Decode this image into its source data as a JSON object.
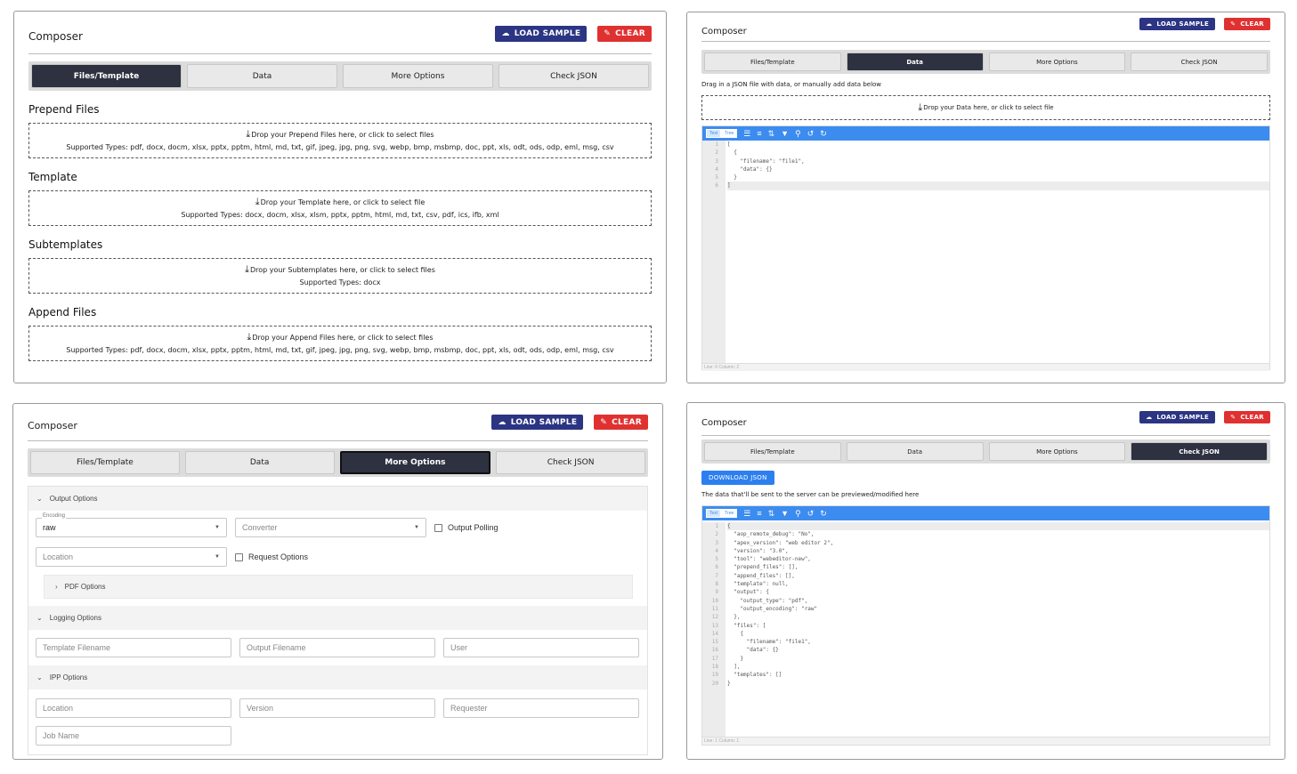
{
  "composer_title": "Composer",
  "buttons": {
    "load_sample": "LOAD SAMPLE",
    "clear": "CLEAR"
  },
  "tabs": [
    "Files/Template",
    "Data",
    "More Options",
    "Check JSON"
  ],
  "colors": {
    "accent": "#2c3583",
    "danger": "#e03131",
    "active_tab": "#2e3140",
    "editor_toolbar": "#3c8cf0"
  },
  "icons": {
    "load": "cloud-upload-icon",
    "clear": "broom-icon",
    "drop": "download-icon"
  },
  "files_template": {
    "sections": [
      {
        "title": "Prepend Files",
        "drop": "Drop your Prepend Files here, or click to select files",
        "types": "Supported Types: pdf, docx, docm, xlsx, pptx, pptm, html, md, txt, gif, jpeg, jpg, png, svg, webp, bmp, msbmp, doc, ppt, xls, odt, ods, odp, eml, msg, csv"
      },
      {
        "title": "Template",
        "drop": "Drop your Template here, or click to select file",
        "types": "Supported Types: docx, docm, xlsx, xlsm, pptx, pptm, html, md, txt, csv, pdf, ics, ifb, xml"
      },
      {
        "title": "Subtemplates",
        "drop": "Drop your Subtemplates here, or click to select files",
        "types": "Supported Types: docx"
      },
      {
        "title": "Append Files",
        "drop": "Drop your Append Files here, or click to select files",
        "types": "Supported Types: pdf, docx, docm, xlsx, pptx, pptm, html, md, txt, gif, jpeg, jpg, png, svg, webp, bmp, msbmp, doc, ppt, xls, odt, ods, odp, eml, msg, csv"
      }
    ]
  },
  "data_tab": {
    "hint": "Drag in a JSON file with data, or manually add data below",
    "drop": "Drop your Data here, or click to select file",
    "editor_modes": [
      "Text",
      "Tree"
    ],
    "lines": [
      "[",
      "  {",
      "    \"filename\": \"file1\",",
      "    \"data\": {}",
      "  }",
      "]"
    ],
    "line_numbers": [
      "1",
      "2",
      "3",
      "4",
      "5",
      "6"
    ],
    "status": "Line: 6    Column: 2"
  },
  "more_options": {
    "output_options": "Output Options",
    "encoding_label": "Encoding",
    "encoding_value": "raw",
    "converter_placeholder": "Converter",
    "output_polling": "Output Polling",
    "location_placeholder": "Location",
    "request_options": "Request Options",
    "pdf_options": "PDF Options",
    "logging_options": "Logging Options",
    "template_filename": "Template Filename",
    "output_filename": "Output Filename",
    "user": "User",
    "ipp_options": "IPP Options",
    "ipp_location": "Location",
    "version": "Version",
    "requester": "Requester",
    "job_name": "Job Name"
  },
  "check_json": {
    "download": "DOWNLOAD JSON",
    "hint": "The data that'll be sent to the server can be previewed/modified here",
    "editor_modes": [
      "Text",
      "Tree"
    ],
    "line_numbers": [
      "1",
      "2",
      "3",
      "4",
      "5",
      "6",
      "7",
      "8",
      "9",
      "10",
      "11",
      "12",
      "13",
      "14",
      "15",
      "16",
      "17",
      "18",
      "19",
      "20"
    ],
    "lines": [
      "{",
      "  \"aop_remote_debug\": \"No\",",
      "  \"apex_version\": \"web editor 2\",",
      "  \"version\": \"3.0\",",
      "  \"tool\": \"webeditor-new\",",
      "  \"prepend_files\": [],",
      "  \"append_files\": [],",
      "  \"template\": null,",
      "  \"output\": {",
      "    \"output_type\": \"pdf\",",
      "    \"output_encoding\": \"raw\"",
      "  },",
      "  \"files\": [",
      "    {",
      "      \"filename\": \"file1\",",
      "      \"data\": {}",
      "    }",
      "  ],",
      "  \"templates\": []",
      "}"
    ],
    "status": "Line: 1    Column: 1"
  }
}
